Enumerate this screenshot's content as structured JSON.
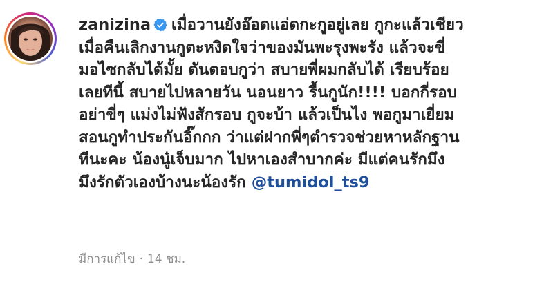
{
  "comment": {
    "username": "zanizina",
    "verified_icon": "verified-badge-icon",
    "lines": [
      "เมื่อวานยังอ๊อดแอ่ดกะกูอยู่เลย กูกะแล้วเชียว",
      "เมื่อคืนเลิกงานกูตะหงิดใจว่าของมันพะรุงพะรัง แล้วจะขี่",
      "มอไซกลับได้มั้ย ดันตอบกูว่า สบายพี่ผมกลับได้ เรียบร้อย",
      "เลยทีนี้ สบายไปหลายวัน นอนยาว รื้นกูนัก!!!! บอกกี่รอบ",
      "อย่าขี่ๆ แม่งไม่ฟังสักรอบ กูจะบ้า แล้วเป็นไง พอกูมาเยี่ยม",
      "สอนกูทำประกันอิ๊กกก ว่าแต่ฝากพี่ๆตำรวจช่วยหาหลักฐาน",
      "ทีนะคะ น้องนู๋เจ็บมาก ไปหาเองสำบากค่ะ มีแต่คนรักมึง",
      "มึงรักตัวเองบ้างนะน้องรัก"
    ],
    "mention": "@tumidol_ts9",
    "edited_label": "มีการแก้ไข",
    "separator": "·",
    "time": "14 ชม."
  },
  "colors": {
    "text": "#262626",
    "mention": "#1f4f9a",
    "meta": "#8e8e8e",
    "verified": "#3897f0"
  }
}
